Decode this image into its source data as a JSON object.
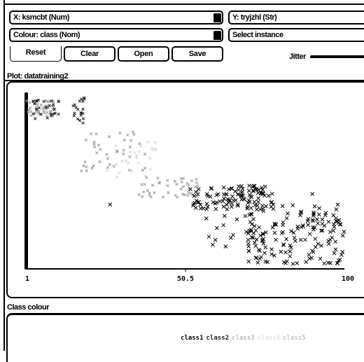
{
  "controls": {
    "x_axis": "X: ksmcbt (Num)",
    "y_axis": "Y: tryjzhl (Str)",
    "colour": "Colour: class (Nom)",
    "select_instance": "Select instance",
    "reset_label": "Reset",
    "clear_label": "Clear",
    "open_label": "Open",
    "save_label": "Save",
    "jitter_label": "Jitter"
  },
  "plot": {
    "title": "Plot: datatraining2"
  },
  "legend": {
    "title": "Class colour",
    "classes": [
      {
        "name": "class1",
        "color": "#000000"
      },
      {
        "name": "class2",
        "color": "#1a1a1a"
      },
      {
        "name": "class3",
        "color": "#9a9a9a"
      },
      {
        "name": "class4",
        "color": "#d8d8d8"
      },
      {
        "name": "class5",
        "color": "#aaaaaa"
      }
    ]
  },
  "chart_data": {
    "type": "scatter",
    "title": "Plot: datatraining2",
    "xlabel": "ksmcbt",
    "ylabel": "tryjzhl",
    "x_ticks": [
      "1",
      "50.5",
      "100"
    ],
    "xlim": [
      1,
      100
    ],
    "ylim": [
      0,
      1
    ],
    "marker": "x",
    "clusters": [
      {
        "class": "class3",
        "x_range": [
          1,
          10
        ],
        "y_range": [
          0.86,
          0.96
        ],
        "count": 45
      },
      {
        "class": "class2",
        "x_range": [
          3,
          12
        ],
        "y_range": [
          0.85,
          0.96
        ],
        "count": 25
      },
      {
        "class": "class2",
        "x_range": [
          15,
          19
        ],
        "y_range": [
          0.82,
          0.97
        ],
        "count": 20
      },
      {
        "class": "class3",
        "x_range": [
          18,
          38
        ],
        "y_range": [
          0.55,
          0.78
        ],
        "count": 40
      },
      {
        "class": "class4",
        "x_range": [
          22,
          42
        ],
        "y_range": [
          0.5,
          0.72
        ],
        "count": 25
      },
      {
        "class": "class3",
        "x_range": [
          36,
          55
        ],
        "y_range": [
          0.4,
          0.52
        ],
        "count": 45
      },
      {
        "class": "class1",
        "x_range": [
          52,
          78
        ],
        "y_range": [
          0.33,
          0.47
        ],
        "count": 110
      },
      {
        "class": "class1",
        "x_range": [
          70,
          100
        ],
        "y_range": [
          0.02,
          0.36
        ],
        "count": 160
      },
      {
        "class": "class1",
        "x_range": [
          56,
          72
        ],
        "y_range": [
          0.15,
          0.3
        ],
        "count": 12
      }
    ],
    "outliers": [
      {
        "x": 27,
        "y": 0.36,
        "class": "class1"
      },
      {
        "x": 59,
        "y": 0.13,
        "class": "class1"
      },
      {
        "x": 63,
        "y": 0.12,
        "class": "class1"
      },
      {
        "x": 90,
        "y": 0.42,
        "class": "class1"
      },
      {
        "x": 57,
        "y": 0.28,
        "class": "class1"
      }
    ]
  }
}
